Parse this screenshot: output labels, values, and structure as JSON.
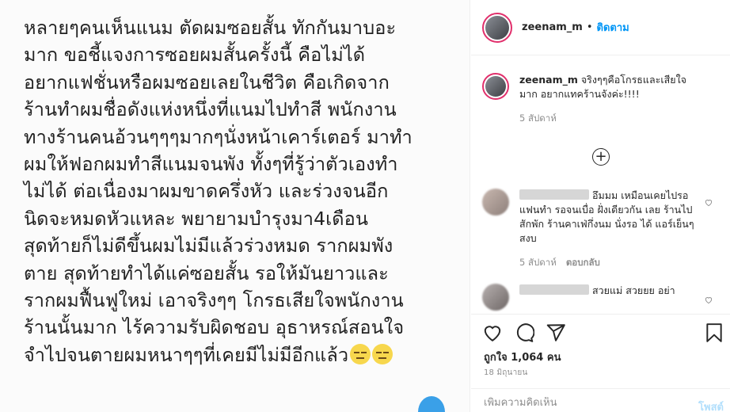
{
  "post_image": {
    "lines": [
      "หลายๆคนเห็นแนม ตัดผมซอยสั้น ทักกันมาบอะ",
      "มาก ขอชี้แจงการซอยผมสั้นครั้งนี้ คือไม่ได้",
      "อยากแฟชั่นหรือผมซอยเลยในชีวิต คือเกิดจาก",
      "ร้านทำผมชื่อดังแห่งหนึ่งที่แนมไปทำสี พนักงาน",
      "ทางร้านคนอ้วนๆๆๆมากๆนั่งหน้าเคาร์เตอร์ มาทำ",
      "ผมให้ฟอกผมทำสีแนมจนพัง ทั้งๆที่รู้ว่าตัวเองทำ",
      "ไม่ได้ ต่อเนื่องมาผมขาดครึ่งหัว และร่วงจนอีก",
      "นิดจะหมดหัวแหละ พยายามบำรุงมา4เดือน",
      "สุดท้ายก็ไม่ดีขึ้นผมไม่มีแล้วร่วงหมด รากผมพัง",
      "ตาย สุดท้ายทำได้แค่ซอยสั้น รอให้มันยาวและ",
      "รากผมฟื้นฟูใหม่ เอาจริงๆๆ โกรธเสียใจพนักงาน",
      "ร้านนั้นมาก ไร้ความรับผิดชอบ อุธาหรณ์สอนใจ",
      "จำไปจนตายผมหนาๆๆที่เคยมีไม่มีอีกแล้ว"
    ]
  },
  "header": {
    "username": "zeenam_m",
    "separator": "•",
    "follow_label": "ติดตาม"
  },
  "comments": {
    "owner": {
      "username": "zeenam_m",
      "text": "จริงๆๆคือโกรธและเสียใจมาก อยากแทคร้านจังค่ะ!!!!",
      "time": "5 สัปดาห์"
    },
    "load_more_symbol": "+",
    "items": [
      {
        "text": "อึมมม เหมือนเคยไปรอแฟนทำ รอจนเบื่อ ฝั่งเดียวกัน เลย ร้านไป สักพัก ร้านคาเฟ่กึ่งนม นั่งรอ ได้ แอร์เย็นๆ สงบ",
        "time": "5 สัปดาห์",
        "reply_label": "ตอบกลับ"
      },
      {
        "text": "สวยแม่ สวยยย อย่า",
        "time": "",
        "reply_label": ""
      }
    ]
  },
  "actions": {
    "likes_text": "ถูกใจ 1,064 คน",
    "date_text": "18 มิถุนายน"
  },
  "add_comment": {
    "placeholder": "เพิ่มความคิดเห็น",
    "post_label": "โพสต์"
  },
  "colors": {
    "accent": "#0095f6",
    "post_disabled": "#b2dffc",
    "muted": "#8e8e8e",
    "text": "#262626",
    "story_ring": "#e1306c",
    "emoji": "#f7d74d"
  },
  "icons": [
    "heart-icon",
    "comment-icon",
    "share-icon",
    "bookmark-icon",
    "plus-circle-icon",
    "small-heart-icon",
    "expressionless-emoji-icon"
  ]
}
